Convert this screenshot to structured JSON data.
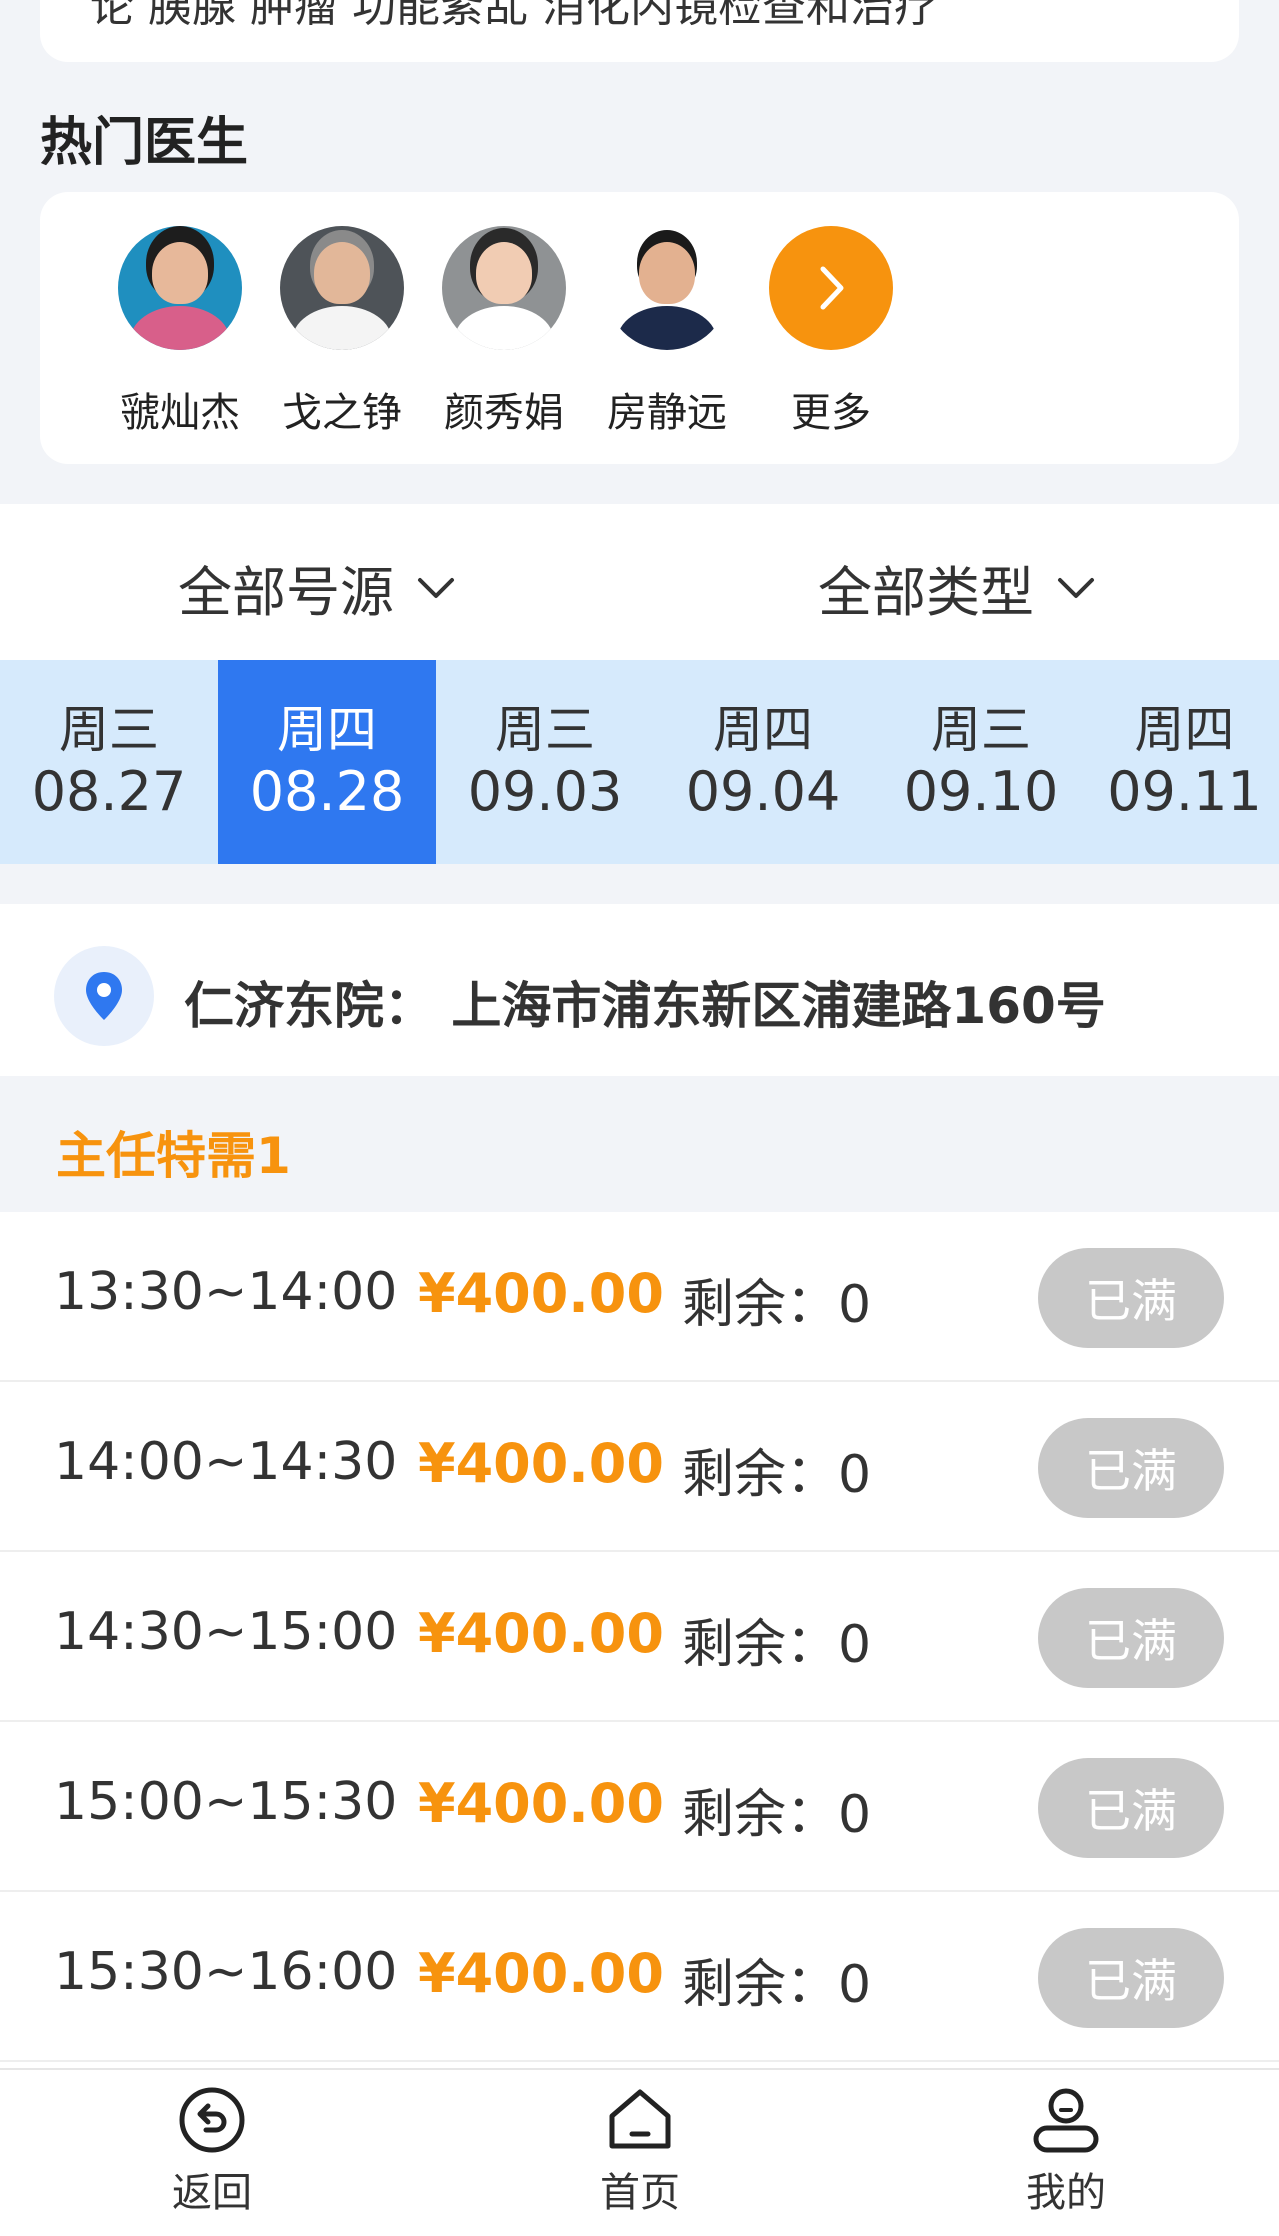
{
  "top_card": {
    "partial_text": "论 胰腺 肿瘤 功能紊乱 消化内镜检查和治疗"
  },
  "section": {
    "title": "热门医生"
  },
  "doctors": [
    {
      "name": "虢灿杰"
    },
    {
      "name": "戈之铮"
    },
    {
      "name": "颜秀娟"
    },
    {
      "name": "房静远"
    }
  ],
  "more": {
    "label": "更多"
  },
  "filters": {
    "source": "全部号源",
    "type": "全部类型"
  },
  "dates": [
    {
      "weekday": "周三",
      "date": "08.27"
    },
    {
      "weekday": "周四",
      "date": "08.28"
    },
    {
      "weekday": "周三",
      "date": "09.03"
    },
    {
      "weekday": "周四",
      "date": "09.04"
    },
    {
      "weekday": "周三",
      "date": "09.10"
    },
    {
      "weekday": "周四",
      "date": "09.11"
    }
  ],
  "address": {
    "text": "仁济东院：  上海市浦东新区浦建路160号"
  },
  "category": {
    "label": "主任特需1"
  },
  "slots": [
    {
      "time": "13:30~14:00",
      "price": "¥400.00",
      "remain": "剩余：0",
      "status": "已满"
    },
    {
      "time": "14:00~14:30",
      "price": "¥400.00",
      "remain": "剩余：0",
      "status": "已满"
    },
    {
      "time": "14:30~15:00",
      "price": "¥400.00",
      "remain": "剩余：0",
      "status": "已满"
    },
    {
      "time": "15:00~15:30",
      "price": "¥400.00",
      "remain": "剩余：0",
      "status": "已满"
    },
    {
      "time": "15:30~16:00",
      "price": "¥400.00",
      "remain": "剩余：0",
      "status": "已满"
    }
  ],
  "tabbar": {
    "back": "返回",
    "home": "首页",
    "mine": "我的"
  },
  "colors": {
    "accent_orange": "#f7930e",
    "active_blue": "#2f78f0",
    "date_strip": "#d6eafc",
    "full_button": "#c8c8c8"
  }
}
